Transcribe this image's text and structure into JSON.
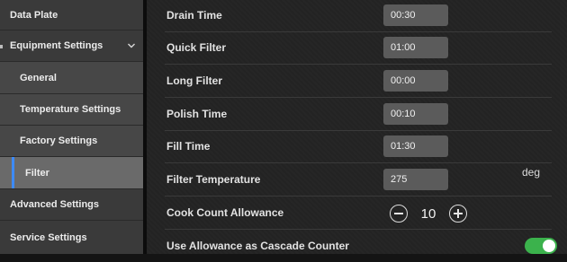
{
  "sidebar": {
    "items": [
      {
        "label": "Data Plate"
      },
      {
        "label": "Equipment Settings"
      },
      {
        "label": "General"
      },
      {
        "label": "Temperature Settings"
      },
      {
        "label": "Factory Settings"
      },
      {
        "label": "Filter"
      },
      {
        "label": "Advanced Settings"
      },
      {
        "label": "Service Settings"
      }
    ],
    "active": "Filter"
  },
  "rows": {
    "drain_time": {
      "label": "Drain Time",
      "value": "00:30"
    },
    "quick_filter": {
      "label": "Quick Filter",
      "value": "01:00"
    },
    "long_filter": {
      "label": "Long Filter",
      "value": "00:00"
    },
    "polish_time": {
      "label": "Polish Time",
      "value": "00:10"
    },
    "fill_time": {
      "label": "Fill Time",
      "value": "01:30"
    },
    "filter_temperature": {
      "label": "Filter Temperature",
      "value": "275",
      "unit": "deg"
    },
    "cook_count_allowance": {
      "label": "Cook Count Allowance",
      "value": "10"
    },
    "use_allowance_cascade": {
      "label": "Use Allowance as Cascade Counter",
      "enabled": true
    }
  },
  "colors": {
    "accent": "#3d8bfd",
    "toggle_on": "#3bb24c"
  }
}
